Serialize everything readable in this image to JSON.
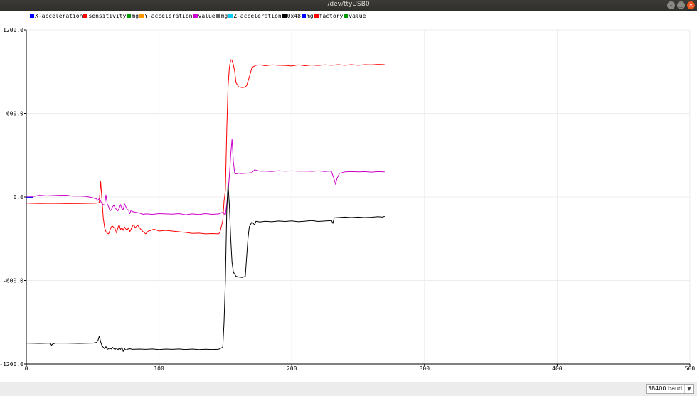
{
  "window": {
    "title": "/dev/ttyUSB0",
    "minimize_glyph": "–",
    "maximize_glyph": "□",
    "close_glyph": "×"
  },
  "legend": [
    {
      "label": "X-acceleration",
      "color": "#0000ff"
    },
    {
      "label": "sensitivity",
      "color": "#ff0000"
    },
    {
      "label": "mg",
      "color": "#009900"
    },
    {
      "label": "Y-acceleration",
      "color": "#ff9900"
    },
    {
      "label": "value",
      "color": "#cc00cc"
    },
    {
      "label": "mg",
      "color": "#666666"
    },
    {
      "label": "Z-acceleration",
      "color": "#00ccff"
    },
    {
      "label": "0x48",
      "color": "#000000"
    },
    {
      "label": "mg",
      "color": "#0000ff"
    },
    {
      "label": "factory",
      "color": "#ff0000"
    },
    {
      "label": "value",
      "color": "#009900"
    }
  ],
  "baud_select": {
    "value": "38400 baud",
    "arrow_icon": "chevron-down-icon"
  },
  "chart_data": {
    "type": "line",
    "xlim": [
      0,
      500
    ],
    "ylim": [
      -1200,
      1200
    ],
    "x_ticks": [
      0,
      100,
      200,
      300,
      400,
      500
    ],
    "x_tick_labels": [
      "0",
      "100",
      "200",
      "300",
      "400",
      "500"
    ],
    "y_ticks": [
      1200,
      600,
      0,
      -600,
      -1200
    ],
    "y_tick_labels": [
      "1200.0",
      "600.0",
      "0.0",
      "-600.0",
      "-1200.0"
    ],
    "grid": true,
    "series": [
      {
        "name": "X-acceleration",
        "color": "#0000ff",
        "points": [
          [
            0,
            -2
          ],
          [
            5,
            -2
          ]
        ]
      },
      {
        "name": "sensitivity",
        "color": "#ff0000",
        "points": [
          [
            0,
            -45
          ],
          [
            10,
            -47
          ],
          [
            20,
            -46
          ],
          [
            30,
            -48
          ],
          [
            40,
            -47
          ],
          [
            50,
            -46
          ],
          [
            53,
            -45
          ],
          [
            55,
            -40
          ],
          [
            56,
            110
          ],
          [
            57,
            -20
          ],
          [
            58,
            -150
          ],
          [
            59,
            -220
          ],
          [
            60,
            -250
          ],
          [
            61,
            -260
          ],
          [
            62,
            -265
          ],
          [
            63,
            -240
          ],
          [
            64,
            -215
          ],
          [
            65,
            -210
          ],
          [
            66,
            -220
          ],
          [
            67,
            -230
          ],
          [
            68,
            -260
          ],
          [
            69,
            -220
          ],
          [
            70,
            -200
          ],
          [
            71,
            -235
          ],
          [
            72,
            -220
          ],
          [
            73,
            -240
          ],
          [
            74,
            -215
          ],
          [
            75,
            -230
          ],
          [
            76,
            -240
          ],
          [
            77,
            -220
          ],
          [
            78,
            -250
          ],
          [
            79,
            -230
          ],
          [
            80,
            -210
          ],
          [
            81,
            -200
          ],
          [
            82,
            -220
          ],
          [
            84,
            -205
          ],
          [
            86,
            -230
          ],
          [
            88,
            -250
          ],
          [
            90,
            -265
          ],
          [
            92,
            -245
          ],
          [
            94,
            -240
          ],
          [
            96,
            -232
          ],
          [
            98,
            -237
          ],
          [
            100,
            -245
          ],
          [
            105,
            -240
          ],
          [
            110,
            -245
          ],
          [
            115,
            -250
          ],
          [
            120,
            -255
          ],
          [
            125,
            -262
          ],
          [
            130,
            -260
          ],
          [
            135,
            -265
          ],
          [
            140,
            -263
          ],
          [
            145,
            -265
          ],
          [
            146,
            -250
          ],
          [
            148,
            -170
          ],
          [
            149,
            -30
          ],
          [
            150,
            50
          ],
          [
            151,
            480
          ],
          [
            152,
            790
          ],
          [
            153,
            930
          ],
          [
            154,
            985
          ],
          [
            155,
            980
          ],
          [
            156,
            950
          ],
          [
            157,
            900
          ],
          [
            158,
            820
          ],
          [
            160,
            790
          ],
          [
            163,
            785
          ],
          [
            165,
            790
          ],
          [
            166,
            800
          ],
          [
            168,
            860
          ],
          [
            170,
            930
          ],
          [
            173,
            945
          ],
          [
            176,
            948
          ],
          [
            180,
            942
          ],
          [
            185,
            948
          ],
          [
            190,
            945
          ],
          [
            195,
            944
          ],
          [
            200,
            940
          ],
          [
            205,
            948
          ],
          [
            210,
            942
          ],
          [
            215,
            947
          ],
          [
            220,
            944
          ],
          [
            225,
            948
          ],
          [
            230,
            945
          ],
          [
            235,
            950
          ],
          [
            240,
            945
          ],
          [
            245,
            950
          ],
          [
            250,
            945
          ],
          [
            255,
            950
          ],
          [
            260,
            948
          ],
          [
            265,
            952
          ],
          [
            270,
            950
          ]
        ]
      },
      {
        "name": "value",
        "color": "#cc00cc",
        "points": [
          [
            0,
            5
          ],
          [
            5,
            4
          ],
          [
            10,
            12
          ],
          [
            15,
            8
          ],
          [
            20,
            10
          ],
          [
            25,
            12
          ],
          [
            30,
            13
          ],
          [
            35,
            6
          ],
          [
            40,
            7
          ],
          [
            45,
            4
          ],
          [
            50,
            -5
          ],
          [
            53,
            -15
          ],
          [
            54,
            -25
          ],
          [
            55,
            -10
          ],
          [
            56,
            -30
          ],
          [
            57,
            -50
          ],
          [
            58,
            -55
          ],
          [
            59,
            -60
          ],
          [
            60,
            15
          ],
          [
            61,
            -50
          ],
          [
            62,
            -70
          ],
          [
            63,
            -100
          ],
          [
            64,
            -95
          ],
          [
            65,
            -70
          ],
          [
            66,
            -60
          ],
          [
            67,
            -80
          ],
          [
            68,
            -90
          ],
          [
            69,
            -100
          ],
          [
            70,
            -80
          ],
          [
            71,
            -55
          ],
          [
            72,
            -85
          ],
          [
            73,
            -90
          ],
          [
            74,
            -50
          ],
          [
            75,
            -70
          ],
          [
            76,
            -90
          ],
          [
            77,
            -95
          ],
          [
            78,
            -120
          ],
          [
            79,
            -95
          ],
          [
            80,
            -105
          ],
          [
            82,
            -110
          ],
          [
            85,
            -115
          ],
          [
            88,
            -125
          ],
          [
            90,
            -122
          ],
          [
            95,
            -125
          ],
          [
            100,
            -120
          ],
          [
            105,
            -122
          ],
          [
            110,
            -124
          ],
          [
            115,
            -120
          ],
          [
            120,
            -128
          ],
          [
            125,
            -122
          ],
          [
            130,
            -126
          ],
          [
            135,
            -120
          ],
          [
            140,
            -125
          ],
          [
            145,
            -122
          ],
          [
            148,
            -110
          ],
          [
            150,
            -130
          ],
          [
            151,
            -50
          ],
          [
            152,
            30
          ],
          [
            153,
            150
          ],
          [
            154,
            305
          ],
          [
            155,
            415
          ],
          [
            156,
            250
          ],
          [
            157,
            170
          ],
          [
            158,
            165
          ],
          [
            160,
            170
          ],
          [
            162,
            168
          ],
          [
            165,
            170
          ],
          [
            168,
            172
          ],
          [
            170,
            175
          ],
          [
            172,
            195
          ],
          [
            174,
            190
          ],
          [
            176,
            185
          ],
          [
            180,
            185
          ],
          [
            185,
            183
          ],
          [
            190,
            188
          ],
          [
            195,
            185
          ],
          [
            200,
            187
          ],
          [
            205,
            185
          ],
          [
            210,
            186
          ],
          [
            215,
            184
          ],
          [
            220,
            187
          ],
          [
            225,
            183
          ],
          [
            229,
            186
          ],
          [
            230,
            180
          ],
          [
            232,
            125
          ],
          [
            233,
            90
          ],
          [
            234,
            130
          ],
          [
            236,
            170
          ],
          [
            240,
            180
          ],
          [
            245,
            182
          ],
          [
            250,
            180
          ],
          [
            255,
            182
          ],
          [
            260,
            178
          ],
          [
            265,
            182
          ],
          [
            270,
            180
          ]
        ]
      },
      {
        "name": "0x48",
        "color": "#000000",
        "points": [
          [
            0,
            -1050
          ],
          [
            10,
            -1052
          ],
          [
            18,
            -1050
          ],
          [
            19,
            -1065
          ],
          [
            20,
            -1055
          ],
          [
            22,
            -1050
          ],
          [
            30,
            -1050
          ],
          [
            40,
            -1052
          ],
          [
            50,
            -1050
          ],
          [
            53,
            -1045
          ],
          [
            54,
            -1030
          ],
          [
            55,
            -1000
          ],
          [
            56,
            -1040
          ],
          [
            57,
            -1070
          ],
          [
            58,
            -1080
          ],
          [
            59,
            -1090
          ],
          [
            60,
            -1075
          ],
          [
            61,
            -1095
          ],
          [
            62,
            -1090
          ],
          [
            63,
            -1085
          ],
          [
            64,
            -1092
          ],
          [
            65,
            -1080
          ],
          [
            66,
            -1090
          ],
          [
            67,
            -1095
          ],
          [
            68,
            -1085
          ],
          [
            69,
            -1100
          ],
          [
            70,
            -1085
          ],
          [
            71,
            -1095
          ],
          [
            72,
            -1080
          ],
          [
            73,
            -1110
          ],
          [
            74,
            -1090
          ],
          [
            75,
            -1100
          ],
          [
            76,
            -1095
          ],
          [
            78,
            -1090
          ],
          [
            80,
            -1095
          ],
          [
            85,
            -1093
          ],
          [
            90,
            -1095
          ],
          [
            95,
            -1092
          ],
          [
            100,
            -1097
          ],
          [
            105,
            -1093
          ],
          [
            110,
            -1095
          ],
          [
            115,
            -1092
          ],
          [
            120,
            -1096
          ],
          [
            125,
            -1093
          ],
          [
            130,
            -1097
          ],
          [
            135,
            -1094
          ],
          [
            140,
            -1096
          ],
          [
            145,
            -1094
          ],
          [
            148,
            -1080
          ],
          [
            149,
            -900
          ],
          [
            150,
            -600
          ],
          [
            151,
            -100
          ],
          [
            152,
            100
          ],
          [
            153,
            -60
          ],
          [
            154,
            -300
          ],
          [
            155,
            -470
          ],
          [
            156,
            -540
          ],
          [
            157,
            -555
          ],
          [
            158,
            -570
          ],
          [
            160,
            -575
          ],
          [
            163,
            -578
          ],
          [
            165,
            -570
          ],
          [
            166,
            -430
          ],
          [
            167,
            -300
          ],
          [
            168,
            -215
          ],
          [
            170,
            -180
          ],
          [
            172,
            -200
          ],
          [
            173,
            -175
          ],
          [
            176,
            -180
          ],
          [
            180,
            -175
          ],
          [
            185,
            -178
          ],
          [
            190,
            -173
          ],
          [
            195,
            -176
          ],
          [
            200,
            -172
          ],
          [
            205,
            -178
          ],
          [
            210,
            -174
          ],
          [
            215,
            -170
          ],
          [
            220,
            -176
          ],
          [
            225,
            -173
          ],
          [
            230,
            -170
          ],
          [
            231,
            -190
          ],
          [
            232,
            -150
          ],
          [
            235,
            -148
          ],
          [
            240,
            -145
          ],
          [
            245,
            -148
          ],
          [
            250,
            -145
          ],
          [
            255,
            -148
          ],
          [
            260,
            -146
          ],
          [
            265,
            -142
          ],
          [
            268,
            -145
          ],
          [
            270,
            -140
          ]
        ]
      }
    ]
  }
}
